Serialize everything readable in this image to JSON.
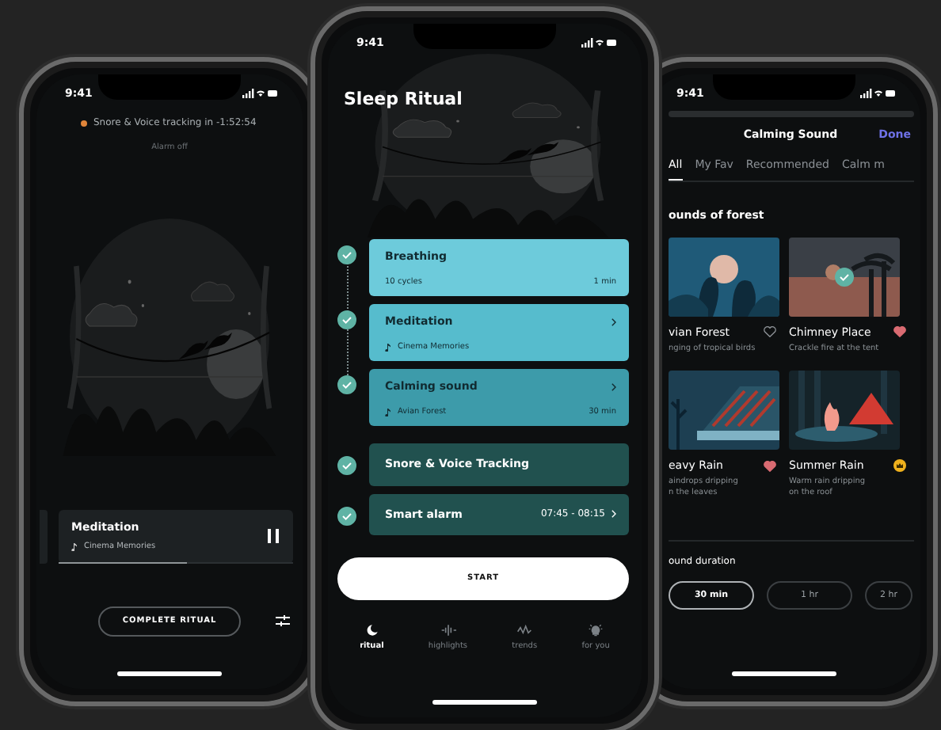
{
  "left_screen": {
    "status_time": "9:41",
    "tracking": "Snore & Voice tracking in -1:52:54",
    "alarm": "Alarm off",
    "now_playing": {
      "title": "Meditation",
      "track": "Cinema Memories",
      "level": 0.55,
      "playing": true
    },
    "button": "COMPLETE RITUAL"
  },
  "center_screen": {
    "status_time": "9:41",
    "title": "Sleep Ritual",
    "steps": [
      {
        "kind": "info",
        "title": "Breathing",
        "detail": "10 cycles",
        "right": "1 min",
        "link": false,
        "done": true,
        "color": "#6dcbdb"
      },
      {
        "kind": "track",
        "title": "Meditation",
        "detail": "Cinema Memories",
        "link": true,
        "done": true,
        "color": "#56bccd"
      },
      {
        "kind": "track",
        "title": "Calming sound",
        "detail": "Avian Forest",
        "right": "30 min",
        "link": true,
        "done": true,
        "color": "#3d9baa"
      },
      {
        "kind": "single",
        "title": "Snore & Voice Tracking",
        "link": false,
        "done": true,
        "color": "#21514f"
      },
      {
        "kind": "single",
        "title": "Smart alarm",
        "right": "07:45 - 08:15",
        "link": true,
        "done": true,
        "color": "#21514f"
      }
    ],
    "start": "START",
    "nav": [
      {
        "label": "ritual",
        "selected": true
      },
      {
        "label": "highlights",
        "selected": false
      },
      {
        "label": "trends",
        "selected": false
      },
      {
        "label": "for you",
        "selected": false
      }
    ]
  },
  "right_screen": {
    "status_time": "9:41",
    "title": "Calming Sound",
    "action": "Done",
    "tabs": [
      {
        "label": "All",
        "selected": true
      },
      {
        "label": "My Fav",
        "selected": false
      },
      {
        "label": "Recommended",
        "selected": false
      },
      {
        "label": "Calm m",
        "selected": false
      }
    ],
    "section": "ounds of forest",
    "sounds": [
      {
        "title": "vian Forest",
        "subtitle": [
          "nging of tropical birds"
        ],
        "favorite": false,
        "premium": false,
        "selected": false
      },
      {
        "title": "Chimney Place",
        "subtitle": [
          "Crackle fire at the tent"
        ],
        "favorite": true,
        "premium": false,
        "selected": true
      },
      {
        "title": "eavy Rain",
        "subtitle": [
          "aindrops dripping",
          "n the leaves"
        ],
        "favorite": true,
        "premium": false,
        "selected": false
      },
      {
        "title": "Summer Rain",
        "subtitle": [
          "Warm rain dripping",
          "on the roof"
        ],
        "favorite": false,
        "premium": true,
        "selected": false
      }
    ],
    "duration_label": "ound duration",
    "durations": [
      {
        "label": "30 min",
        "selected": true
      },
      {
        "label": "1 hr",
        "selected": false
      },
      {
        "label": "2 hr",
        "selected": false
      }
    ]
  }
}
